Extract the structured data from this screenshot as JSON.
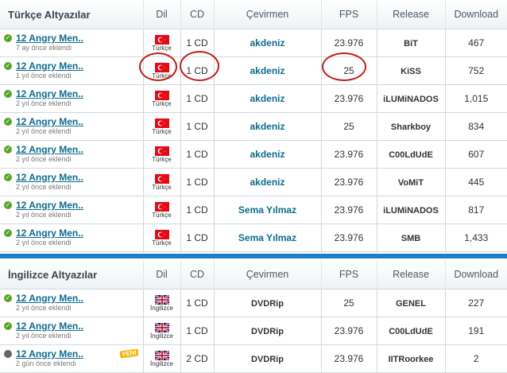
{
  "turkish": {
    "title": "Türkçe Altyazılar",
    "rows": [
      {
        "name": "12 Angry Men..",
        "ago": "7 ay önce eklendi",
        "lang": "Türkçe",
        "cd": "1 CD",
        "translator": "akdeniz",
        "fps": "23.976",
        "release": "BiT",
        "downloads": "467"
      },
      {
        "name": "12 Angry Men..",
        "ago": "1 yıl önce eklendi",
        "lang": "Türkçe",
        "cd": "1 CD",
        "translator": "akdeniz",
        "fps": "25",
        "release": "KiSS",
        "downloads": "752"
      },
      {
        "name": "12 Angry Men..",
        "ago": "2 yıl önce eklendi",
        "lang": "Türkçe",
        "cd": "1 CD",
        "translator": "akdeniz",
        "fps": "23.976",
        "release": "iLUMiNADOS",
        "downloads": "1,015"
      },
      {
        "name": "12 Angry Men..",
        "ago": "2 yıl önce eklendi",
        "lang": "Türkçe",
        "cd": "1 CD",
        "translator": "akdeniz",
        "fps": "25",
        "release": "Sharkboy",
        "downloads": "834"
      },
      {
        "name": "12 Angry Men..",
        "ago": "2 yıl önce eklendi",
        "lang": "Türkçe",
        "cd": "1 CD",
        "translator": "akdeniz",
        "fps": "23.976",
        "release": "C00LdUdE",
        "downloads": "607"
      },
      {
        "name": "12 Angry Men..",
        "ago": "2 yıl önce eklendi",
        "lang": "Türkçe",
        "cd": "1 CD",
        "translator": "akdeniz",
        "fps": "23.976",
        "release": "VoMiT",
        "downloads": "445"
      },
      {
        "name": "12 Angry Men..",
        "ago": "2 yıl önce eklendi",
        "lang": "Türkçe",
        "cd": "1 CD",
        "translator": "Sema Yılmaz",
        "fps": "23.976",
        "release": "iLUMiNADOS",
        "downloads": "817"
      },
      {
        "name": "12 Angry Men..",
        "ago": "2 yıl önce eklendi",
        "lang": "Türkçe",
        "cd": "1 CD",
        "translator": "Sema Yılmaz",
        "fps": "23.976",
        "release": "SMB",
        "downloads": "1,433"
      }
    ]
  },
  "english": {
    "title": "İngilizce Altyazılar",
    "rows": [
      {
        "name": "12 Angry Men..",
        "ago": "2 yıl önce eklendi",
        "lang": "İngilizce",
        "cd": "1 CD",
        "translator": "DVDRip",
        "fps": "25",
        "release": "GENEL",
        "downloads": "227"
      },
      {
        "name": "12 Angry Men..",
        "ago": "2 yıl önce eklendi",
        "lang": "İngilizce",
        "cd": "1 CD",
        "translator": "DVDRip",
        "fps": "23.976",
        "release": "C00LdUdE",
        "downloads": "191"
      },
      {
        "name": "12 Angry Men..",
        "ago": "2 gün önce eklendi",
        "lang": "İngilizce",
        "cd": "2 CD",
        "translator": "DVDRip",
        "fps": "23.976",
        "release": "IITRoorkee",
        "downloads": "2",
        "new_badge": "YENİ"
      }
    ]
  },
  "columns": {
    "lang": "Dil",
    "cd": "CD",
    "translator": "Çevirmen",
    "fps": "FPS",
    "release": "Release",
    "downloads": "Download"
  },
  "colors": {
    "accent": "#1e7fc8",
    "link": "#0c6b8e",
    "ok": "#57a626",
    "annotation": "#c11b1b"
  }
}
